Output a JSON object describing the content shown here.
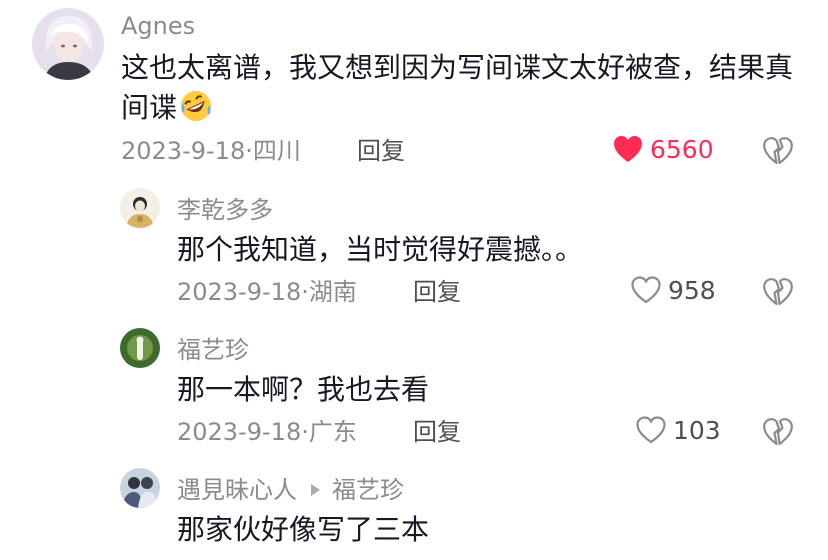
{
  "comments": [
    {
      "author": "Agnes",
      "text": "这也太离谱，我又想到因为写间谍文太好被查，结果真间谍",
      "emoji_icon": "rolling-on-floor-laughing-emoji",
      "date": "2023-9-18",
      "location": "四川",
      "reply_label": "回复",
      "likes": "6560",
      "liked": true
    },
    {
      "author": "李乾多多",
      "text": "那个我知道，当时觉得好震撼。。",
      "date": "2023-9-18",
      "location": "湖南",
      "reply_label": "回复",
      "likes": "958",
      "liked": false
    },
    {
      "author": "福艺珍",
      "text": "那一本啊？我也去看",
      "date": "2023-9-18",
      "location": "广东",
      "reply_label": "回复",
      "likes": "103",
      "liked": false
    },
    {
      "author": "遇見昧心人",
      "reply_to": "福艺珍",
      "text": "那家伙好像写了三本"
    }
  ],
  "meta_separator": "·",
  "icons": {
    "like": "heart-icon",
    "dislike": "broken-heart-icon",
    "reply_arrow": "play-arrow-icon"
  },
  "colors": {
    "liked": "#fe2c55",
    "muted": "#8a8b91",
    "text": "#161823"
  }
}
